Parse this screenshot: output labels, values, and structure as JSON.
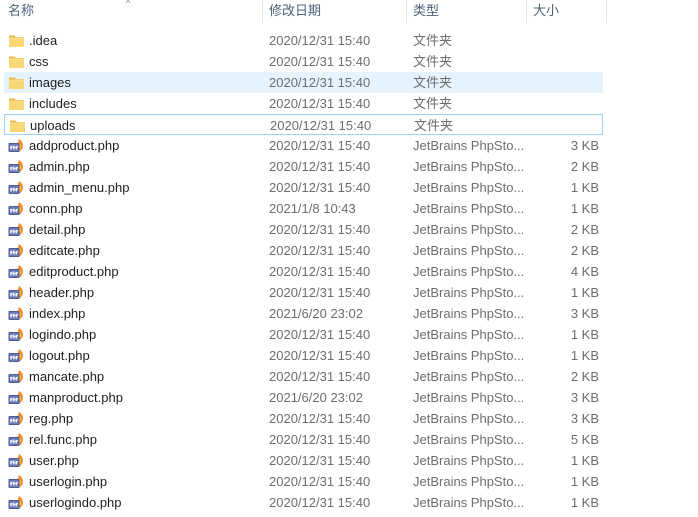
{
  "header": {
    "name": "名称",
    "date": "修改日期",
    "type": "类型",
    "size": "大小"
  },
  "colors": {
    "folder": "#f8d775",
    "hover_bg": "#e5f3ff",
    "focus_border": "#99d1ff",
    "php_icon": "#4f5b93"
  },
  "files": [
    {
      "name": ".idea",
      "date": "2020/12/31 15:40",
      "type": "文件夹",
      "size": "",
      "icon": "folder-icon"
    },
    {
      "name": "css",
      "date": "2020/12/31 15:40",
      "type": "文件夹",
      "size": "",
      "icon": "folder-icon"
    },
    {
      "name": "images",
      "date": "2020/12/31 15:40",
      "type": "文件夹",
      "size": "",
      "icon": "folder-icon"
    },
    {
      "name": "includes",
      "date": "2020/12/31 15:40",
      "type": "文件夹",
      "size": "",
      "icon": "folder-icon"
    },
    {
      "name": "uploads",
      "date": "2020/12/31 15:40",
      "type": "文件夹",
      "size": "",
      "icon": "folder-icon"
    },
    {
      "name": "addproduct.php",
      "date": "2020/12/31 15:40",
      "type": "JetBrains PhpSto...",
      "size": "3 KB",
      "icon": "php-file-icon"
    },
    {
      "name": "admin.php",
      "date": "2020/12/31 15:40",
      "type": "JetBrains PhpSto...",
      "size": "2 KB",
      "icon": "php-file-icon"
    },
    {
      "name": "admin_menu.php",
      "date": "2020/12/31 15:40",
      "type": "JetBrains PhpSto...",
      "size": "1 KB",
      "icon": "php-file-icon"
    },
    {
      "name": "conn.php",
      "date": "2021/1/8 10:43",
      "type": "JetBrains PhpSto...",
      "size": "1 KB",
      "icon": "php-file-icon"
    },
    {
      "name": "detail.php",
      "date": "2020/12/31 15:40",
      "type": "JetBrains PhpSto...",
      "size": "2 KB",
      "icon": "php-file-icon"
    },
    {
      "name": "editcate.php",
      "date": "2020/12/31 15:40",
      "type": "JetBrains PhpSto...",
      "size": "2 KB",
      "icon": "php-file-icon"
    },
    {
      "name": "editproduct.php",
      "date": "2020/12/31 15:40",
      "type": "JetBrains PhpSto...",
      "size": "4 KB",
      "icon": "php-file-icon"
    },
    {
      "name": "header.php",
      "date": "2020/12/31 15:40",
      "type": "JetBrains PhpSto...",
      "size": "1 KB",
      "icon": "php-file-icon"
    },
    {
      "name": "index.php",
      "date": "2021/6/20 23:02",
      "type": "JetBrains PhpSto...",
      "size": "3 KB",
      "icon": "php-file-icon"
    },
    {
      "name": "logindo.php",
      "date": "2020/12/31 15:40",
      "type": "JetBrains PhpSto...",
      "size": "1 KB",
      "icon": "php-file-icon"
    },
    {
      "name": "logout.php",
      "date": "2020/12/31 15:40",
      "type": "JetBrains PhpSto...",
      "size": "1 KB",
      "icon": "php-file-icon"
    },
    {
      "name": "mancate.php",
      "date": "2020/12/31 15:40",
      "type": "JetBrains PhpSto...",
      "size": "2 KB",
      "icon": "php-file-icon"
    },
    {
      "name": "manproduct.php",
      "date": "2021/6/20 23:02",
      "type": "JetBrains PhpSto...",
      "size": "3 KB",
      "icon": "php-file-icon"
    },
    {
      "name": "reg.php",
      "date": "2020/12/31 15:40",
      "type": "JetBrains PhpSto...",
      "size": "3 KB",
      "icon": "php-file-icon"
    },
    {
      "name": "rel.func.php",
      "date": "2020/12/31 15:40",
      "type": "JetBrains PhpSto...",
      "size": "5 KB",
      "icon": "php-file-icon"
    },
    {
      "name": "user.php",
      "date": "2020/12/31 15:40",
      "type": "JetBrains PhpSto...",
      "size": "1 KB",
      "icon": "php-file-icon"
    },
    {
      "name": "userlogin.php",
      "date": "2020/12/31 15:40",
      "type": "JetBrains PhpSto...",
      "size": "1 KB",
      "icon": "php-file-icon"
    },
    {
      "name": "userlogindo.php",
      "date": "2020/12/31 15:40",
      "type": "JetBrains PhpSto...",
      "size": "1 KB",
      "icon": "php-file-icon"
    }
  ]
}
